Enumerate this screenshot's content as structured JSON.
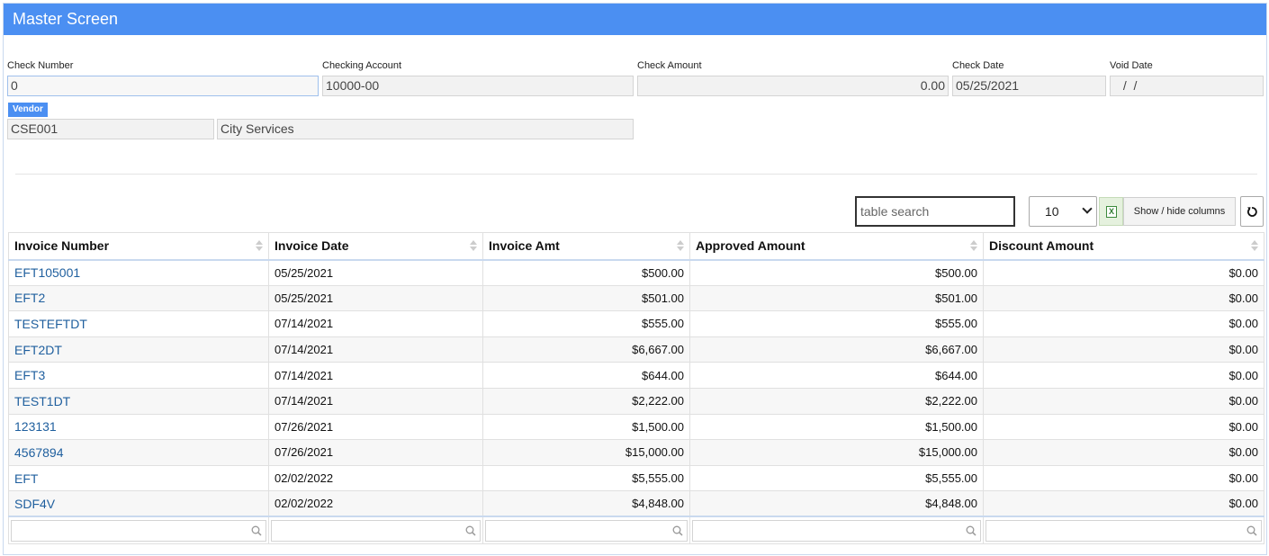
{
  "header": {
    "title": "Master Screen"
  },
  "form": {
    "check_number": {
      "label": "Check Number",
      "value": "0"
    },
    "checking_account": {
      "label": "Checking Account",
      "value": "10000-00"
    },
    "check_amount": {
      "label": "Check Amount",
      "value": "0.00"
    },
    "check_date": {
      "label": "Check Date",
      "value": "05/25/2021"
    },
    "void_date": {
      "label": "Void Date",
      "value": " /  /"
    },
    "vendor": {
      "label": "Vendor",
      "code": "CSE001",
      "name": "City Services"
    }
  },
  "toolbar": {
    "search_placeholder": "table search",
    "page_size": "10",
    "excel_icon_letter": "X",
    "show_hide_label": "Show / hide columns"
  },
  "table": {
    "columns": [
      "Invoice Number",
      "Invoice Date",
      "Invoice Amt",
      "Approved Amount",
      "Discount Amount"
    ],
    "rows": [
      [
        "EFT105001",
        "05/25/2021",
        "$500.00",
        "$500.00",
        "$0.00"
      ],
      [
        "EFT2",
        "05/25/2021",
        "$501.00",
        "$501.00",
        "$0.00"
      ],
      [
        "TESTEFTDT",
        "07/14/2021",
        "$555.00",
        "$555.00",
        "$0.00"
      ],
      [
        "EFT2DT",
        "07/14/2021",
        "$6,667.00",
        "$6,667.00",
        "$0.00"
      ],
      [
        "EFT3",
        "07/14/2021",
        "$644.00",
        "$644.00",
        "$0.00"
      ],
      [
        "TEST1DT",
        "07/14/2021",
        "$2,222.00",
        "$2,222.00",
        "$0.00"
      ],
      [
        "123131",
        "07/26/2021",
        "$1,500.00",
        "$1,500.00",
        "$0.00"
      ],
      [
        "4567894",
        "07/26/2021",
        "$15,000.00",
        "$15,000.00",
        "$0.00"
      ],
      [
        "EFT",
        "02/02/2022",
        "$5,555.00",
        "$5,555.00",
        "$0.00"
      ],
      [
        "SDF4V",
        "02/02/2022",
        "$4,848.00",
        "$4,848.00",
        "$0.00"
      ]
    ]
  },
  "colors": {
    "header_bg": "#4b8ff2",
    "link": "#1f5f9e",
    "accent_border": "#c9d9ef"
  }
}
